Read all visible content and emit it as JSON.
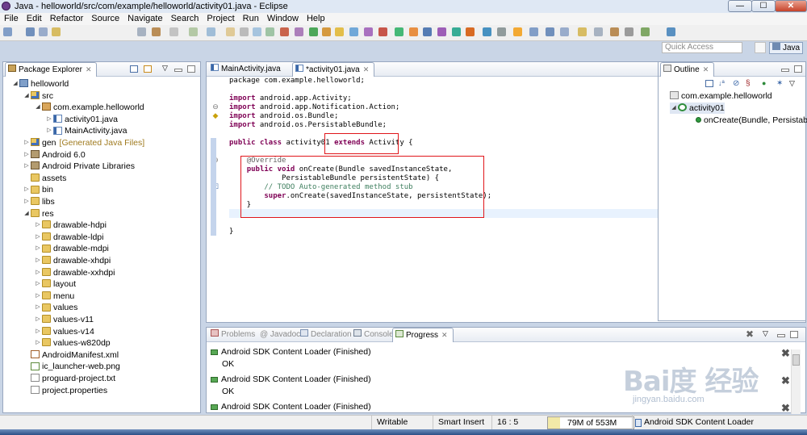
{
  "window": {
    "title": "Java - helloworld/src/com/example/helloworld/activity01.java - Eclipse",
    "controls": [
      "—",
      "☐",
      "✕"
    ]
  },
  "menu": [
    "File",
    "Edit",
    "Refactor",
    "Source",
    "Navigate",
    "Search",
    "Project",
    "Run",
    "Window",
    "Help"
  ],
  "quick_access": {
    "placeholder": "Quick Access"
  },
  "perspective": {
    "label": "Java"
  },
  "package_explorer": {
    "title": "Package Explorer",
    "items": [
      {
        "label": "helloworld",
        "indent": 0,
        "twisty": "◢",
        "icon": "project-icon"
      },
      {
        "label": "src",
        "indent": 1,
        "twisty": "◢",
        "icon": "source-folder-icon"
      },
      {
        "label": "com.example.helloworld",
        "indent": 2,
        "twisty": "◢",
        "icon": "package-icon"
      },
      {
        "label": "activity01.java",
        "indent": 3,
        "twisty": "▷",
        "icon": "java-file-icon"
      },
      {
        "label": "MainActivity.java",
        "indent": 3,
        "twisty": "▷",
        "icon": "java-file-icon"
      },
      {
        "label": "gen",
        "extra": "[Generated Java Files]",
        "indent": 1,
        "twisty": "▷",
        "icon": "source-folder-icon"
      },
      {
        "label": "Android 6.0",
        "indent": 1,
        "twisty": "▷",
        "icon": "library-icon"
      },
      {
        "label": "Android Private Libraries",
        "indent": 1,
        "twisty": "▷",
        "icon": "library-icon"
      },
      {
        "label": "assets",
        "indent": 1,
        "twisty": "",
        "icon": "folder-icon"
      },
      {
        "label": "bin",
        "indent": 1,
        "twisty": "▷",
        "icon": "folder-icon"
      },
      {
        "label": "libs",
        "indent": 1,
        "twisty": "▷",
        "icon": "folder-icon"
      },
      {
        "label": "res",
        "indent": 1,
        "twisty": "◢",
        "icon": "folder-icon"
      },
      {
        "label": "drawable-hdpi",
        "indent": 2,
        "twisty": "▷",
        "icon": "folder-icon"
      },
      {
        "label": "drawable-ldpi",
        "indent": 2,
        "twisty": "▷",
        "icon": "folder-icon"
      },
      {
        "label": "drawable-mdpi",
        "indent": 2,
        "twisty": "▷",
        "icon": "folder-icon"
      },
      {
        "label": "drawable-xhdpi",
        "indent": 2,
        "twisty": "▷",
        "icon": "folder-icon"
      },
      {
        "label": "drawable-xxhdpi",
        "indent": 2,
        "twisty": "▷",
        "icon": "folder-icon"
      },
      {
        "label": "layout",
        "indent": 2,
        "twisty": "▷",
        "icon": "folder-icon"
      },
      {
        "label": "menu",
        "indent": 2,
        "twisty": "▷",
        "icon": "folder-icon"
      },
      {
        "label": "values",
        "indent": 2,
        "twisty": "▷",
        "icon": "folder-icon"
      },
      {
        "label": "values-v11",
        "indent": 2,
        "twisty": "▷",
        "icon": "folder-icon"
      },
      {
        "label": "values-v14",
        "indent": 2,
        "twisty": "▷",
        "icon": "folder-icon"
      },
      {
        "label": "values-w820dp",
        "indent": 2,
        "twisty": "▷",
        "icon": "folder-icon"
      },
      {
        "label": "AndroidManifest.xml",
        "indent": 1,
        "twisty": "",
        "icon": "xml-file-icon"
      },
      {
        "label": "ic_launcher-web.png",
        "indent": 1,
        "twisty": "",
        "icon": "image-file-icon"
      },
      {
        "label": "proguard-project.txt",
        "indent": 1,
        "twisty": "",
        "icon": "text-file-icon"
      },
      {
        "label": "project.properties",
        "indent": 1,
        "twisty": "",
        "icon": "text-file-icon"
      }
    ]
  },
  "editor": {
    "tabs": [
      {
        "label": "MainActivity.java",
        "active": false
      },
      {
        "label": "*activity01.java",
        "active": true
      }
    ],
    "lines": [
      [
        {
          "t": "package com.example.helloworld;"
        }
      ],
      [
        {
          "t": ""
        }
      ],
      [
        {
          "t": "import",
          "c": "kw"
        },
        {
          "t": " android.app.Activity;"
        }
      ],
      [
        {
          "t": "import",
          "c": "kw"
        },
        {
          "t": " android.app.Notification.Action;"
        }
      ],
      [
        {
          "t": "import",
          "c": "kw"
        },
        {
          "t": " android.os.Bundle;"
        }
      ],
      [
        {
          "t": "import",
          "c": "kw"
        },
        {
          "t": " android.os.PersistableBundle;"
        }
      ],
      [
        {
          "t": ""
        }
      ],
      [
        {
          "t": "public",
          "c": "kw"
        },
        {
          "t": " "
        },
        {
          "t": "class",
          "c": "kw"
        },
        {
          "t": " activity01 "
        },
        {
          "t": "extends",
          "c": "kw"
        },
        {
          "t": " Activity {"
        }
      ],
      [
        {
          "t": ""
        }
      ],
      [
        {
          "t": "    "
        },
        {
          "t": "@Override",
          "c": "an"
        }
      ],
      [
        {
          "t": "    "
        },
        {
          "t": "public",
          "c": "kw"
        },
        {
          "t": " "
        },
        {
          "t": "void",
          "c": "kw"
        },
        {
          "t": " onCreate(Bundle savedInstanceState,"
        }
      ],
      [
        {
          "t": "            PersistableBundle persistentState) {"
        }
      ],
      [
        {
          "t": "        "
        },
        {
          "t": "// TODO Auto-generated method stub",
          "c": "cm"
        }
      ],
      [
        {
          "t": "        "
        },
        {
          "t": "super",
          "c": "kw"
        },
        {
          "t": ".onCreate(savedInstanceState, persistentState);"
        }
      ],
      [
        {
          "t": "    }"
        }
      ],
      [
        {
          "t": ""
        }
      ],
      [
        {
          "t": ""
        }
      ],
      [
        {
          "t": "}"
        }
      ]
    ]
  },
  "outline": {
    "title": "Outline",
    "items": [
      {
        "label": "com.example.helloworld",
        "icon": "import-icon"
      },
      {
        "label": "activity01",
        "icon": "class-icon"
      },
      {
        "label": "onCreate(Bundle, Persistab",
        "icon": "method-icon"
      }
    ]
  },
  "bottom": {
    "tabs": [
      "Problems",
      "@ Javadoc",
      "Declaration",
      "Console",
      "Progress"
    ],
    "active_tab": "Progress",
    "entries": [
      {
        "title": "Android SDK Content Loader (Finished)",
        "status": "OK"
      },
      {
        "title": "Android SDK Content Loader (Finished)",
        "status": "OK"
      },
      {
        "title": "Android SDK Content Loader (Finished)",
        "status": ""
      }
    ]
  },
  "status": {
    "mode": "Writable",
    "insert": "Smart Insert",
    "position": "16 : 5",
    "heap": "79M of 553M",
    "heap_used_fraction": 0.14,
    "job": "Android SDK Content Loader"
  },
  "watermark": {
    "text": "Bai度 经验",
    "url": "jingyan.baidu.com"
  },
  "colors": {
    "keyword": "#7f0055",
    "comment": "#3f7f5f",
    "annotation": "#646464",
    "highlight_box": "#e0161b"
  }
}
